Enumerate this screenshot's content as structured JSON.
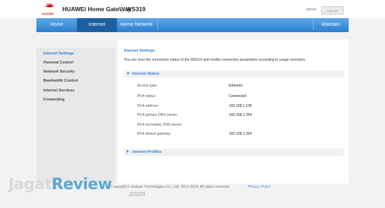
{
  "header": {
    "brand_small": "HUAWEI",
    "brand_title": "HUAWEI Home GateWay",
    "model": "WS319",
    "user": "admin",
    "logout_label": "Log out",
    "logo_color": "#cc0000"
  },
  "nav": {
    "items": [
      {
        "label": "Home"
      },
      {
        "label": "Internet",
        "active": true
      },
      {
        "label": "Home Network"
      },
      {
        "label": "Maintain"
      }
    ],
    "active_color": "#1c5f9e",
    "bar_color": "#2b7ed0"
  },
  "sidebar": {
    "items": [
      {
        "label": "Internet Settings",
        "active": true
      },
      {
        "label": "Parental Control"
      },
      {
        "label": "Network Security"
      },
      {
        "label": "Bandwidth Control"
      },
      {
        "label": "Internet Services"
      },
      {
        "label": "Forwarding"
      }
    ],
    "accent_color": "#2f7ed8"
  },
  "content": {
    "title": "Internet Settings",
    "description": "You can view the connection status of the WS319 and modify connection parameters according to usage scenarios",
    "status_section": {
      "label": "Internet Status",
      "expanded": true,
      "rows": [
        {
          "label": "Access type:",
          "value": "Ethernet"
        },
        {
          "label": "IPv4 status:",
          "value": "Connected"
        },
        {
          "label": "IPv4 address:",
          "value": "192.168.1.108"
        },
        {
          "label": "IPv4 primary DNS server:",
          "value": "192.168.1.254"
        },
        {
          "label": "IPv4 secondary DNS server:",
          "value": ""
        },
        {
          "label": "IPv4 default gateway:",
          "value": "192.168.1.254"
        }
      ]
    },
    "profiles_section": {
      "label": "Internet Profiles",
      "expanded": false
    }
  },
  "footer": {
    "copyright": "Copyright © Huawei Technologies Co., Ltd. 2012-2014. All rights reserved.",
    "privacy": "Privacy Policy"
  },
  "watermark": {
    "part1": "Jagat",
    "part2": "Review",
    "suffix": ".com"
  }
}
